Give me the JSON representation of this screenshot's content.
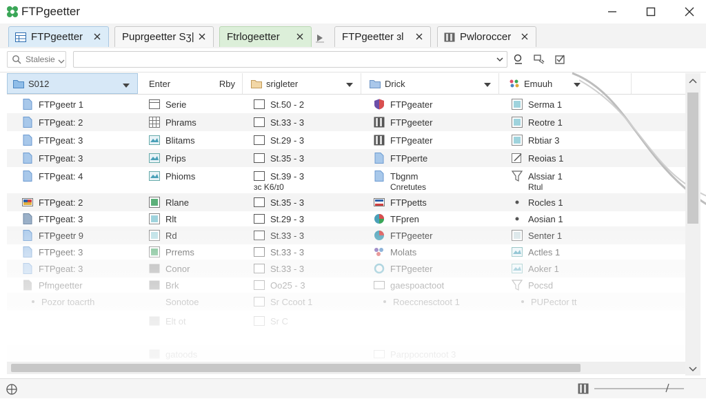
{
  "window": {
    "title": "FTPgeetter",
    "colors": {
      "tab_active": "#dcecf8",
      "tab_green": "#dcefd9",
      "selection": "#d7e8f7",
      "logo": "#3aa657"
    }
  },
  "tabs": [
    {
      "label": "FTPgeetter",
      "icon": "table-icon",
      "state": "active"
    },
    {
      "label": "Puprgeetter Sʒ|",
      "icon": "none",
      "state": "normal"
    },
    {
      "label": "Ftrlogeetter",
      "icon": "none",
      "state": "green"
    },
    {
      "label": "FTPgeetter ɜl",
      "icon": "none",
      "state": "normal"
    },
    {
      "label": "Pwloroccer",
      "icon": "server-icon",
      "state": "normal"
    }
  ],
  "toolbar": {
    "select_label": "Stalesie",
    "path_value": ""
  },
  "columns": [
    {
      "label": "S012",
      "extra": "",
      "icon": "folder-icon"
    },
    {
      "label": "Enter",
      "extra": "Rby",
      "icon": "none"
    },
    {
      "label": "srigleter",
      "extra": "",
      "icon": "folder-icon"
    },
    {
      "label": "Drick",
      "extra": "",
      "icon": "folder-icon"
    },
    {
      "label": "Emuuh",
      "extra": "",
      "icon": "palette-icon"
    }
  ],
  "rows": [
    {
      "c1": "FTPgeetr 1",
      "c2": "Serie",
      "c3": "St.50 - 2",
      "c4": "FTPgeater",
      "c5": "Serma 1"
    },
    {
      "c1": "FTPgeat: 2",
      "c2": "Phrams",
      "c3": "St.33 - 3",
      "c4": "FTPgeeter",
      "c5": "Reotre 1"
    },
    {
      "c1": "FTPgeat: 3",
      "c2": "Blitams",
      "c3": "St.29 - 3",
      "c4": "FTPgeater",
      "c5": "Rbtiar 3"
    },
    {
      "c1": "FTPgeat: 3",
      "c2": "Prips",
      "c3": "St.35 - 3",
      "c4": "FTPperte",
      "c5": "Reoias 1"
    },
    {
      "c1": "FTPgeat: 4",
      "c2": "Phioms",
      "c3": "St.39 - 3",
      "c4": "Tbgnm",
      "c5": "Alssiar 1"
    },
    {
      "c1": "FTPgeat: 2",
      "c2": "Rlane",
      "c3": "St.35 - 3",
      "c4": "FTPpetts",
      "c5": "Rocles 1"
    },
    {
      "c1": "FTPgeat: 3",
      "c2": "Rlt",
      "c3": "St.29 - 3",
      "c4": "TFpren",
      "c5": "Aosian 1"
    },
    {
      "c1": "FTPgeetr 9",
      "c2": "Rd",
      "c3": "St.33 - 3",
      "c4": "FTPgeeter",
      "c5": "Senter 1"
    },
    {
      "c1": "FTPgeet: 3",
      "c2": "Prrems",
      "c3": "St.33 - 3",
      "c4": "Molats",
      "c5": "Actles 1"
    },
    {
      "c1": "FTPgeat: 3",
      "c2": "Conor",
      "c3": "St.33 - 3",
      "c4": "FTPgeeter",
      "c5": "Aoker 1"
    },
    {
      "c1": "Pfmgeetter",
      "c2": "Brk",
      "c3": "Oo25 - 3",
      "c4": "gaespoactoot",
      "c5": "Pocsd"
    },
    {
      "c1": "Pozor toacrth",
      "c2": "Sonotoe",
      "c3": "Sr Ccoot 1",
      "c4": "Roeccnesctoot 1",
      "c5": "PUPector tt"
    },
    {
      "c1": "",
      "c2": "Elt ot",
      "c3": "Sr C",
      "c4": "",
      "c5": ""
    },
    {
      "c1": "",
      "c2": "gatoods",
      "c3": "",
      "c4": "Parppocontoot 3",
      "c5": ""
    }
  ],
  "sublabels": {
    "row4_c3": "ɜc K6/ɪ0",
    "row4_c4": "Cnretutes",
    "row4_c5": "Rtul"
  }
}
